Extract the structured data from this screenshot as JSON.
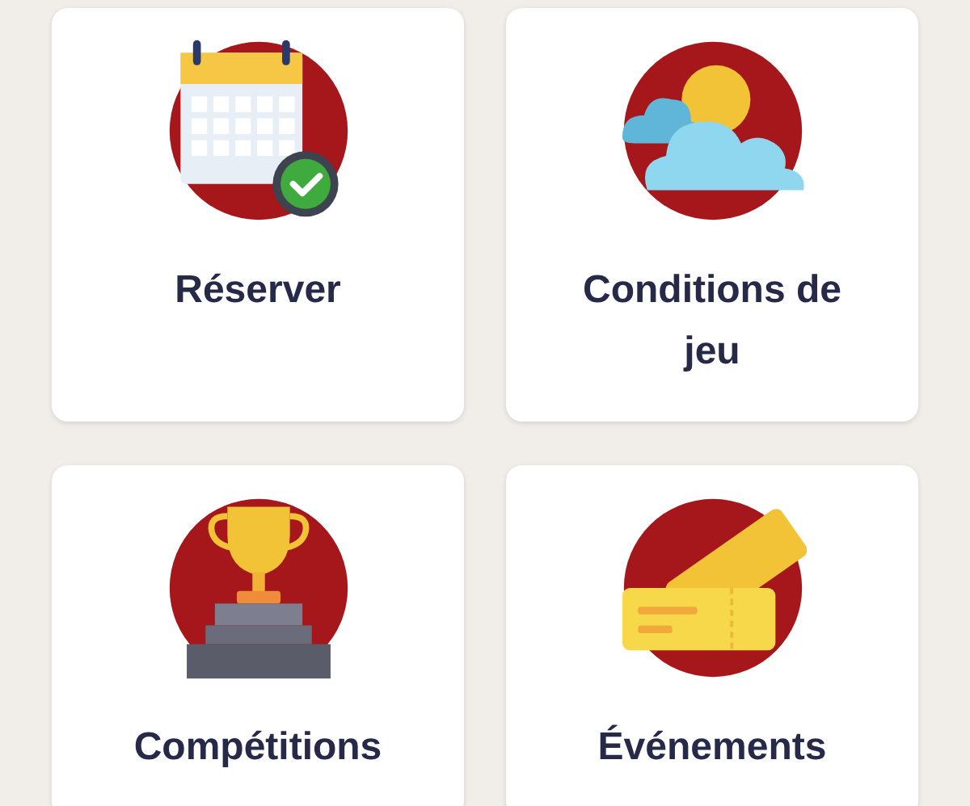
{
  "tiles": [
    {
      "kind": "calendar",
      "label": "Réserver"
    },
    {
      "kind": "weather",
      "label": "Conditions de jeu"
    },
    {
      "kind": "trophy",
      "label": "Compétitions"
    },
    {
      "kind": "tickets",
      "label": "Événements"
    }
  ]
}
